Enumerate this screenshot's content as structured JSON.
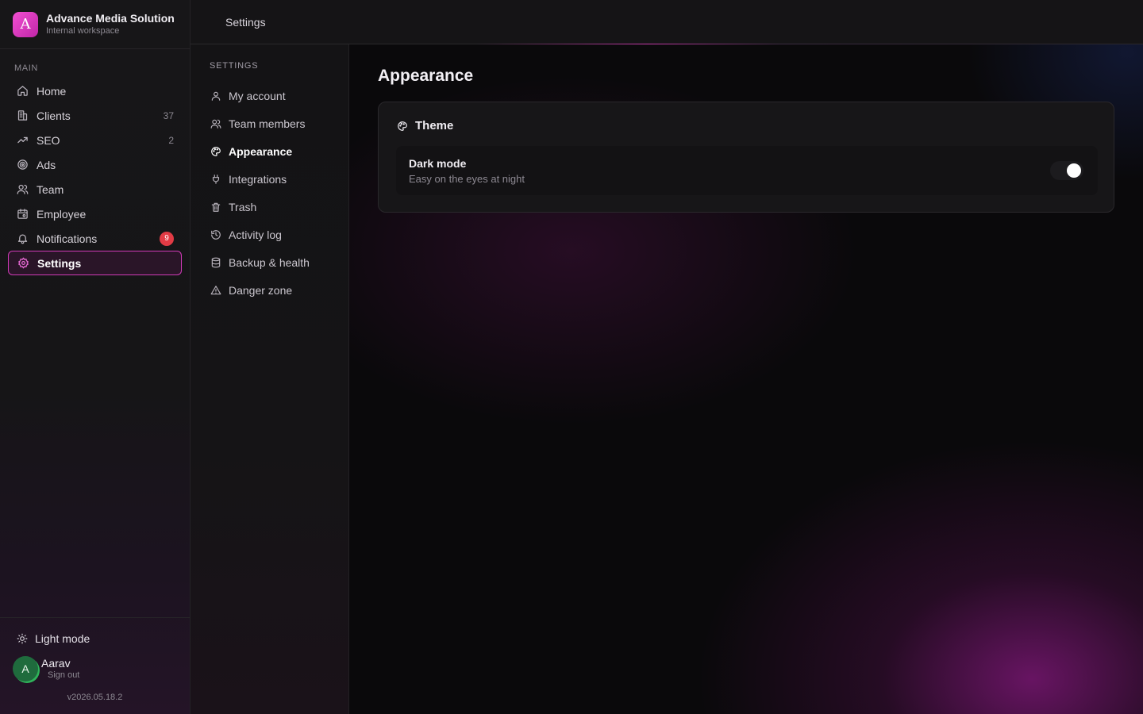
{
  "brand": {
    "logo_letter": "A",
    "name": "Advance Media Solution",
    "subtitle": "Internal workspace"
  },
  "sidebar": {
    "section_label": "MAIN",
    "items": [
      {
        "label": "Home",
        "icon": "home-icon"
      },
      {
        "label": "Clients",
        "icon": "building-icon",
        "count": "37"
      },
      {
        "label": "SEO",
        "icon": "trending-up-icon",
        "count": "2"
      },
      {
        "label": "Ads",
        "icon": "target-icon"
      },
      {
        "label": "Team",
        "icon": "users-icon"
      },
      {
        "label": "Employee",
        "icon": "calendar-user-icon"
      },
      {
        "label": "Notifications",
        "icon": "bell-icon",
        "badge": "9"
      },
      {
        "label": "Settings",
        "icon": "gear-icon",
        "active": true
      }
    ],
    "footer": {
      "theme_toggle_label": "Light mode",
      "user": {
        "initial": "A",
        "name": "Aarav",
        "action": "Sign out"
      },
      "version": "v2026.05.18.2"
    }
  },
  "topbar": {
    "title": "Settings"
  },
  "settings_nav": {
    "title": "SETTINGS",
    "items": [
      {
        "label": "My account",
        "icon": "user-icon"
      },
      {
        "label": "Team members",
        "icon": "users-icon"
      },
      {
        "label": "Appearance",
        "icon": "palette-icon",
        "active": true
      },
      {
        "label": "Integrations",
        "icon": "plug-icon"
      },
      {
        "label": "Trash",
        "icon": "trash-icon"
      },
      {
        "label": "Activity log",
        "icon": "history-icon"
      },
      {
        "label": "Backup & health",
        "icon": "database-icon"
      },
      {
        "label": "Danger zone",
        "icon": "warning-icon"
      }
    ]
  },
  "main": {
    "title": "Appearance",
    "theme_card": {
      "heading": "Theme",
      "dark_mode": {
        "label": "Dark mode",
        "description": "Easy on the eyes at night",
        "enabled": true
      }
    }
  },
  "colors": {
    "accent": "#d13ab8",
    "badge": "#e23b45",
    "avatar": "#1f6b3d",
    "background": "#0a090b"
  }
}
